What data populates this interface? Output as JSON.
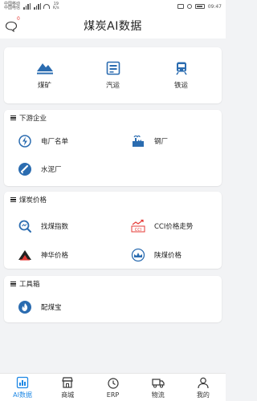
{
  "status_bar": {
    "carrier1": "中国移动",
    "carrier2": "中国电信",
    "speed_value": "19",
    "speed_unit": "K/s",
    "time": "09:47"
  },
  "header": {
    "title": "煤炭AI数据",
    "badge": "0"
  },
  "transport": [
    {
      "label": "煤矿",
      "icon": "coal-mine-icon"
    },
    {
      "label": "汽运",
      "icon": "truck-icon"
    },
    {
      "label": "铁运",
      "icon": "train-icon"
    }
  ],
  "downstream": {
    "title": "下游企业",
    "items": [
      {
        "label": "电厂名单",
        "icon": "power-plant-icon"
      },
      {
        "label": "钢厂",
        "icon": "steel-mill-icon"
      },
      {
        "label": "水泥厂",
        "icon": "cement-plant-icon"
      }
    ]
  },
  "coal_price": {
    "title": "煤炭价格",
    "items": [
      {
        "label": "找煤指数",
        "icon": "search-index-icon"
      },
      {
        "label": "CCI价格走势",
        "icon": "cci-trend-icon"
      },
      {
        "label": "神华价格",
        "icon": "shenhua-icon"
      },
      {
        "label": "陕煤价格",
        "icon": "shaanxi-coal-icon"
      }
    ]
  },
  "tools": {
    "title": "工具箱",
    "items": [
      {
        "label": "配煤宝",
        "icon": "coal-blend-icon"
      }
    ]
  },
  "bottom_nav": [
    {
      "label": "AI数据",
      "icon": "ai-data-icon",
      "active": true
    },
    {
      "label": "商城",
      "icon": "shop-icon",
      "active": false
    },
    {
      "label": "ERP",
      "icon": "erp-icon",
      "active": false
    },
    {
      "label": "物流",
      "icon": "logistics-icon",
      "active": false
    },
    {
      "label": "我的",
      "icon": "profile-icon",
      "active": false
    }
  ],
  "colors": {
    "primary": "#1e88e5",
    "icon_blue": "#2b6cb0",
    "accent_red": "#e53935",
    "background": "#f2f3f5"
  }
}
